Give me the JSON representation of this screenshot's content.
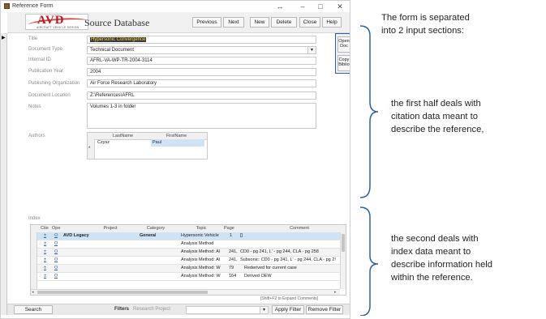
{
  "window": {
    "title": "Reference Form",
    "restore_glyph": "↔",
    "minimize_glyph": "–",
    "maximize_glyph": "□",
    "close_glyph": "✕"
  },
  "header": {
    "logo_brand": "AVD",
    "logo_tagline": "AIRCRAFT VEHICLE DESIGN",
    "form_title": "Source Database",
    "buttons": {
      "previous": "Previous",
      "next": "Next",
      "new": "New",
      "delete": "Delete",
      "close": "Close",
      "help": "Help"
    }
  },
  "side_buttons": {
    "open_doc_line1": "Open",
    "open_doc_line2": "Doc",
    "copy_biblio_line1": "Copy",
    "copy_biblio_line2": "Biblio"
  },
  "citation": {
    "title_label": "Title",
    "title_value": "Hypersonic Convergence",
    "doctype_label": "Document Type",
    "doctype_value": "Technical Document",
    "internal_id_label": "Internal ID",
    "internal_id_value": "AFRL-VA-WP-TR-2004-3114",
    "pub_year_label": "Publication Year",
    "pub_year_value": "2004",
    "pub_org_label": "Publishing Organization",
    "pub_org_value": "Air Force Research Laboratory",
    "doc_location_label": "Document Location",
    "doc_location_value": "Z:\\References\\AFRL",
    "notes_label": "Notes",
    "notes_value": "Volumes 1-3 in folder"
  },
  "authors": {
    "label": "Authors",
    "columns": {
      "last": "LastName",
      "first": "FirstName"
    },
    "rows": [
      {
        "last": "Czysz",
        "first": "Paul"
      }
    ],
    "new_row_marker": "*"
  },
  "index": {
    "label": "Index",
    "columns": {
      "cite": "Cite",
      "open": "Ope",
      "project": "Project",
      "category": "Category",
      "topic": "Topic",
      "page": "Page",
      "comment": "Comment"
    },
    "rows": [
      {
        "cite": "±",
        "open": "O",
        "project": "AVD Legacy",
        "category": "General",
        "topic": "Hypersonic Vehicle",
        "page": "1",
        "comment": "[]"
      },
      {
        "cite": "±",
        "open": "O",
        "project": "",
        "category": "",
        "topic": "Analysis Method",
        "page": "",
        "comment": ""
      },
      {
        "cite": "±",
        "open": "O",
        "project": "",
        "category": "",
        "topic": "Analysis Method: Al",
        "page": "241,",
        "comment": "CD0 - pg 241, L' - pg 244, CLA - pg 258"
      },
      {
        "cite": "±",
        "open": "O",
        "project": "",
        "category": "",
        "topic": "Analysis Method: Al",
        "page": "241,",
        "comment": "Subsonic: CD0 - pg 241, L' - pg 244, CLA - pg 2!"
      },
      {
        "cite": "±",
        "open": "O",
        "project": "",
        "category": "",
        "topic": "Analysis Method: W",
        "page": "79",
        "comment": "Rederived for current case"
      },
      {
        "cite": "±",
        "open": "O",
        "project": "",
        "category": "",
        "topic": "Analysis Method: W",
        "page": "164",
        "comment": "Derived OEW"
      }
    ],
    "hint": "[Shift+F2 to Expand Comments]"
  },
  "footer": {
    "search": "Search",
    "filters_label": "Filters",
    "filter_placeholder": "Research Project",
    "apply_filter": "Apply Filter",
    "remove_filter": "Remove Filter"
  },
  "annotations": {
    "intro": [
      "The form is separated",
      "into 2 input sections:"
    ],
    "first": [
      "the first half deals with",
      "citation data  meant to",
      "describe the reference,"
    ],
    "second": [
      "the second deals with",
      "index data meant to",
      "describe information  held",
      "within the reference."
    ]
  },
  "colors": {
    "brand": "#c8161d",
    "accent": "#2e5fa5",
    "selection_row": "#cfe3f7"
  }
}
